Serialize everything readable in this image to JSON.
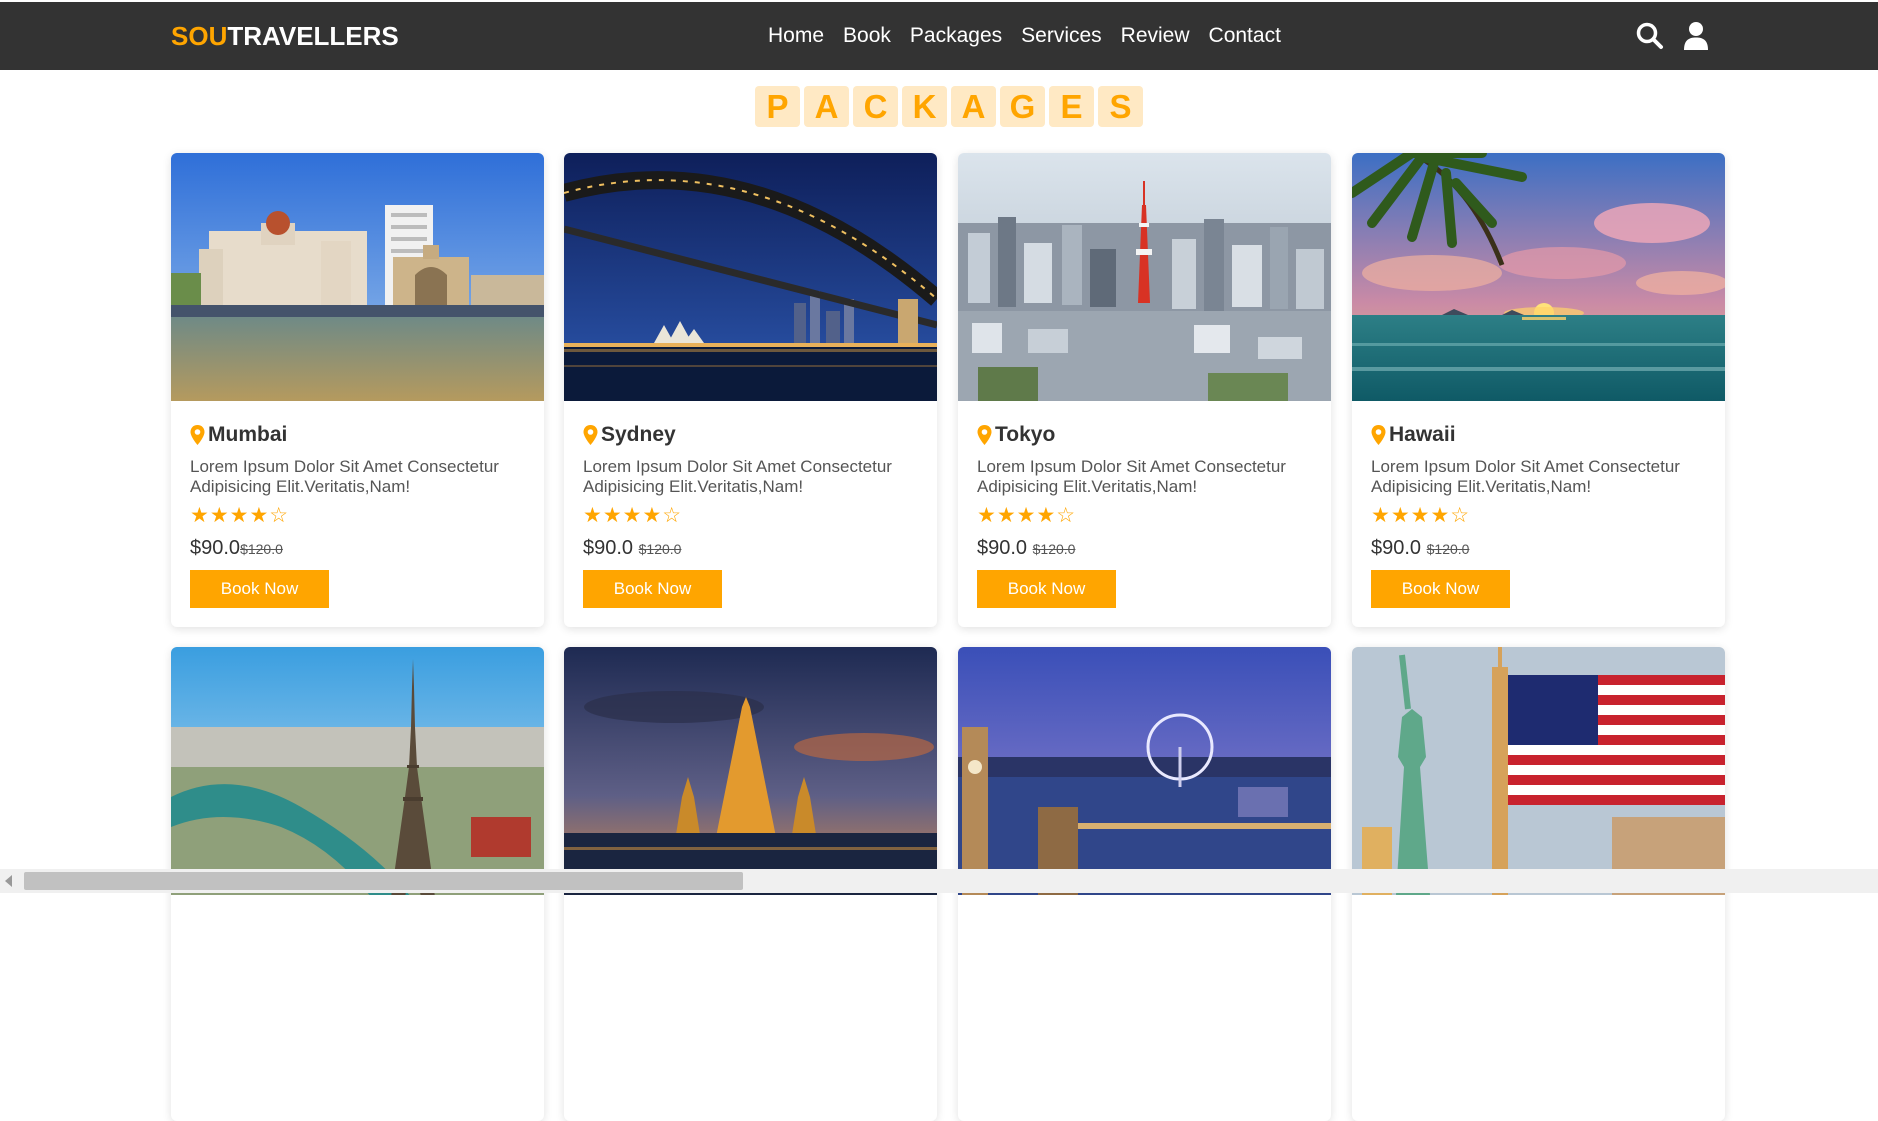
{
  "navbar": {
    "logo_accent": "SOU",
    "logo_rest": "TRAVELLERS",
    "links": [
      "Home",
      "Book",
      "Packages",
      "Services",
      "Review",
      "Contact"
    ]
  },
  "section": {
    "heading_letters": [
      "P",
      "A",
      "C",
      "K",
      "A",
      "G",
      "E",
      "S"
    ]
  },
  "packages": [
    {
      "city": "Mumbai",
      "description": "Lorem Ipsum Dolor Sit Amet Consectetur Adipisicing Elit.Veritatis,Nam!",
      "rating": 4,
      "stars": "★★★★☆",
      "price": "$90.0",
      "old_price": "$120.0",
      "button": "Book Now"
    },
    {
      "city": "Sydney",
      "description": "Lorem Ipsum Dolor Sit Amet Consectetur Adipisicing Elit.Veritatis,Nam!",
      "rating": 4,
      "stars": "★★★★☆",
      "price": "$90.0",
      "old_price": "$120.0",
      "button": "Book Now"
    },
    {
      "city": "Tokyo",
      "description": "Lorem Ipsum Dolor Sit Amet Consectetur Adipisicing Elit.Veritatis,Nam!",
      "rating": 4,
      "stars": "★★★★☆",
      "price": "$90.0",
      "old_price": "$120.0",
      "button": "Book Now"
    },
    {
      "city": "Hawaii",
      "description": "Lorem Ipsum Dolor Sit Amet Consectetur Adipisicing Elit.Veritatis,Nam!",
      "rating": 4,
      "stars": "★★★★☆",
      "price": "$90.0",
      "old_price": "$120.0",
      "button": "Book Now"
    }
  ],
  "colors": {
    "accent": "#ffa500",
    "navbar_bg": "#333333",
    "heading_bg": "#ffe9c4"
  },
  "icons": [
    "search-icon",
    "user-icon",
    "map-pin-icon",
    "star-icon"
  ]
}
